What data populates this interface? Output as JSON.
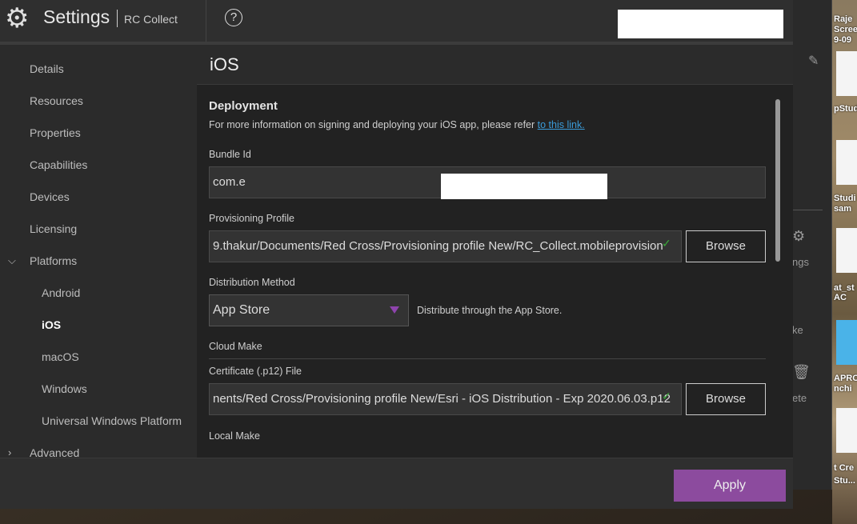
{
  "header": {
    "title": "Settings",
    "subtitle": "RC Collect",
    "icons": [
      "gear-icon",
      "help-icon"
    ]
  },
  "sidebar": {
    "items": [
      {
        "label": "Details"
      },
      {
        "label": "Resources"
      },
      {
        "label": "Properties"
      },
      {
        "label": "Capabilities"
      },
      {
        "label": "Devices"
      },
      {
        "label": "Licensing"
      },
      {
        "label": "Platforms",
        "expanded": true
      },
      {
        "label": "Android"
      },
      {
        "label": "iOS",
        "active": true
      },
      {
        "label": "macOS"
      },
      {
        "label": "Windows"
      },
      {
        "label": "Universal Windows Platform"
      },
      {
        "label": "Advanced",
        "expanded": false
      }
    ]
  },
  "main": {
    "title": "iOS",
    "section": "Deployment",
    "info": "For more information on signing and deploying your iOS app, please refer",
    "info_link": "to this link.",
    "bundle_label": "Bundle Id",
    "bundle_value": "com.e",
    "prov_label": "Provisioning Profile",
    "prov_value": "9.thakur/Documents/Red Cross/Provisioning profile New/RC_Collect.mobileprovision",
    "browse": "Browse",
    "dist_label": "Distribution Method",
    "dist_value": "App Store",
    "dist_desc": "Distribute through the App Store.",
    "cloud_make": "Cloud Make",
    "cert_label": "Certificate (.p12) File",
    "cert_value": "nents/Red Cross/Provisioning profile New/Esri - iOS Distribution - Exp 2020.06.03.p12",
    "local_make": "Local Make"
  },
  "footer": {
    "apply": "Apply"
  },
  "background": {
    "panel_items": [
      "ngs",
      "ke",
      "ete"
    ],
    "desktop_labels": [
      "Raje",
      "Scree",
      "9-09",
      "pStud",
      "Studi",
      "sam",
      "at_st",
      "AC",
      "APRO",
      "nchi",
      "t Cre",
      "Stu..."
    ]
  },
  "colors": {
    "accent": "#8c4b9e",
    "link": "#3a9bd9",
    "check": "#3aa63a"
  }
}
